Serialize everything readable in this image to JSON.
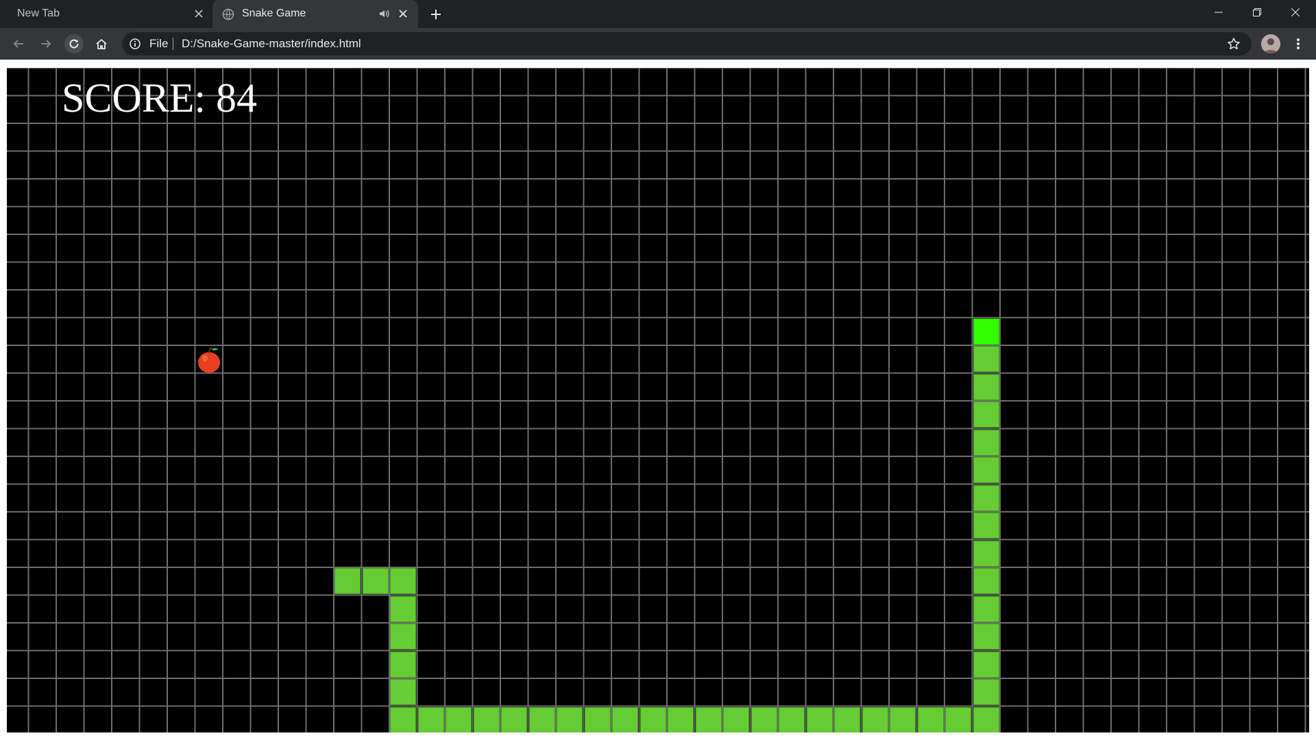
{
  "browser": {
    "tabs": [
      {
        "title": "New Tab",
        "active": false
      },
      {
        "title": "Snake Game",
        "active": true,
        "audio": true
      }
    ],
    "address": {
      "scheme": "File",
      "url": "D:/Snake-Game-master/index.html"
    }
  },
  "game": {
    "score_text": "SCORE: 84",
    "background": "#000000",
    "grid_color": "#6e6e6e",
    "snake_color": "#66cc33",
    "head_color": "#33ff00",
    "food": {
      "type": "apple",
      "color": "#e8401c",
      "cell": [
        7,
        10
      ]
    },
    "snake": [
      [
        35,
        9
      ],
      [
        35,
        10
      ],
      [
        35,
        11
      ],
      [
        35,
        12
      ],
      [
        35,
        13
      ],
      [
        35,
        14
      ],
      [
        35,
        15
      ],
      [
        35,
        16
      ],
      [
        35,
        17
      ],
      [
        35,
        18
      ],
      [
        35,
        19
      ],
      [
        35,
        20
      ],
      [
        35,
        21
      ],
      [
        35,
        22
      ],
      [
        35,
        23
      ],
      [
        34,
        23
      ],
      [
        33,
        23
      ],
      [
        32,
        23
      ],
      [
        31,
        23
      ],
      [
        30,
        23
      ],
      [
        29,
        23
      ],
      [
        28,
        23
      ],
      [
        27,
        23
      ],
      [
        26,
        23
      ],
      [
        25,
        23
      ],
      [
        24,
        23
      ],
      [
        23,
        23
      ],
      [
        22,
        23
      ],
      [
        21,
        23
      ],
      [
        20,
        23
      ],
      [
        19,
        23
      ],
      [
        18,
        23
      ],
      [
        17,
        23
      ],
      [
        16,
        23
      ],
      [
        15,
        23
      ],
      [
        14,
        23
      ],
      [
        14,
        22
      ],
      [
        14,
        21
      ],
      [
        14,
        20
      ],
      [
        14,
        19
      ],
      [
        14,
        18
      ],
      [
        13,
        18
      ],
      [
        12,
        18
      ]
    ]
  }
}
